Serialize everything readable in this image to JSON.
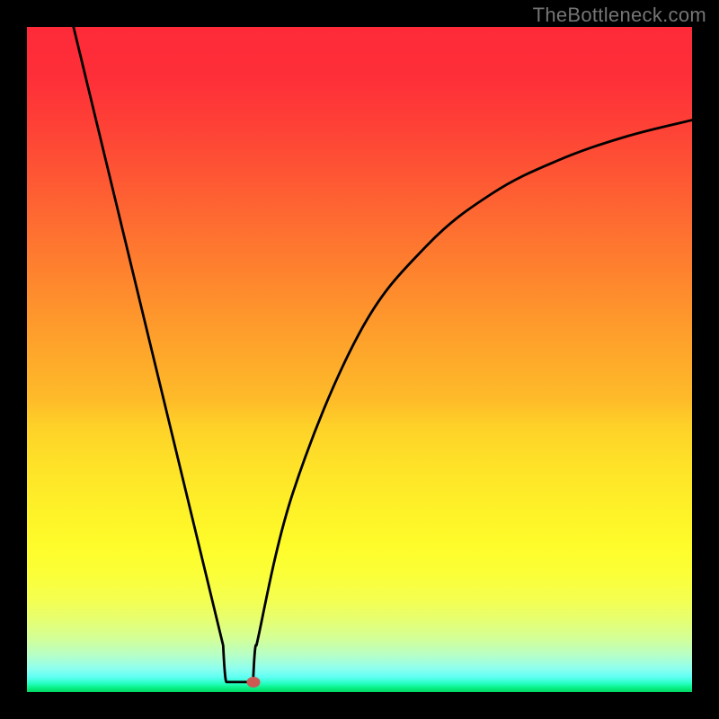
{
  "watermark": "TheBottleneck.com",
  "chart_data": {
    "type": "line",
    "title": "",
    "xlabel": "",
    "ylabel": "",
    "xlim": [
      0,
      100
    ],
    "ylim": [
      0,
      100
    ],
    "series": [
      {
        "name": "curve",
        "points": [
          {
            "x": 7,
            "y": 100
          },
          {
            "x": 29.5,
            "y": 7
          },
          {
            "x": 30,
            "y": 1.5
          },
          {
            "x": 34,
            "y": 1.5
          },
          {
            "x": 34.5,
            "y": 7
          },
          {
            "x": 40,
            "y": 30
          },
          {
            "x": 50,
            "y": 54
          },
          {
            "x": 60,
            "y": 67
          },
          {
            "x": 70,
            "y": 75
          },
          {
            "x": 80,
            "y": 80
          },
          {
            "x": 90,
            "y": 83.5
          },
          {
            "x": 100,
            "y": 86
          }
        ]
      }
    ],
    "marker": {
      "x": 34,
      "y": 1.5
    },
    "background_gradient": {
      "top": "#fe2a38",
      "mid": "#fefc2a",
      "bottom": "#00d760"
    }
  }
}
